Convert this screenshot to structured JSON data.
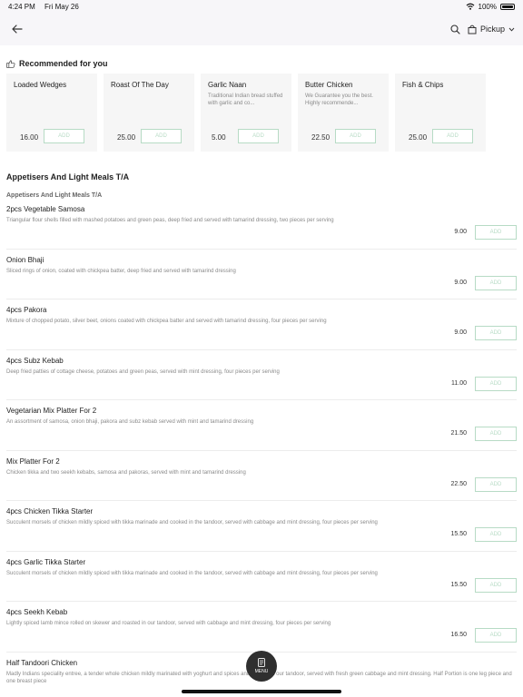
{
  "status": {
    "time": "4:24 PM",
    "date": "Fri May 26",
    "battery": "100%"
  },
  "header": {
    "pickup_label": "Pickup"
  },
  "recommended": {
    "title": "Recommended for you",
    "items": [
      {
        "name": "Loaded Wedges",
        "desc": "",
        "price": "16.00",
        "add": "ADD"
      },
      {
        "name": "Roast Of The Day",
        "desc": "",
        "price": "25.00",
        "add": "ADD"
      },
      {
        "name": "Garlic Naan",
        "desc": "Traditional Indian bread stuffed with garlic and co...",
        "price": "5.00",
        "add": "ADD"
      },
      {
        "name": "Butter Chicken",
        "desc": "We Guarantee you the best. Highly recommende...",
        "price": "22.50",
        "add": "ADD"
      },
      {
        "name": "Fish & Chips",
        "desc": "",
        "price": "25.00",
        "add": "ADD"
      }
    ]
  },
  "section": {
    "title": "Appetisers And Light Meals T/A",
    "subtitle": "Appetisers And Light Meals T/A"
  },
  "menu": [
    {
      "name": "2pcs Vegetable Samosa",
      "desc": "Triangular flour shells filled with mashed potatoes and green peas, deep fried and served with tamarind dressing, two pieces per serving",
      "price": "9.00",
      "add": "ADD"
    },
    {
      "name": "Onion Bhaji",
      "desc": "Sliced rings of onion, coated with chickpea batter, deep fried and served with tamarind dressing",
      "price": "9.00",
      "add": "ADD"
    },
    {
      "name": "4pcs Pakora",
      "desc": "Mixture of chopped potato, silver beet, onions coated with chickpea batter and served with tamarind dressing, four pieces per serving",
      "price": "9.00",
      "add": "ADD"
    },
    {
      "name": "4pcs Subz Kebab",
      "desc": "Deep fried patties of cottage cheese, potatoes and green peas, served with mint dressing, four pieces per serving",
      "price": "11.00",
      "add": "ADD"
    },
    {
      "name": "Vegetarian Mix Platter For 2",
      "desc": "An assortment of samosa, onion bhaji, pakora and subz kebab served with mint and tamarind dressing",
      "price": "21.50",
      "add": "ADD"
    },
    {
      "name": "Mix Platter For 2",
      "desc": "Chicken tikka and two seekh kebabs, samosa and pakoras, served with mint and tamarind dressing",
      "price": "22.50",
      "add": "ADD"
    },
    {
      "name": "4pcs Chicken Tikka Starter",
      "desc": "Succulent morsels of chicken mildly spiced with tikka marinade and cooked in the tandoor, served with cabbage and mint dressing, four pieces per serving",
      "price": "15.50",
      "add": "ADD"
    },
    {
      "name": "4pcs Garlic Tikka Starter",
      "desc": "Succulent morsels of chicken mildly spiced with tikka marinade and cooked in the tandoor, served with cabbage and mint dressing, four pieces per serving",
      "price": "15.50",
      "add": "ADD"
    },
    {
      "name": "4pcs Seekh Kebab",
      "desc": "Lightly spiced lamb mince rolled on skewer and roasted in our tandoor, served with cabbage and mint dressing, four pieces per serving",
      "price": "16.50",
      "add": "ADD"
    },
    {
      "name": "Half Tandoori Chicken",
      "desc": "Madly Indians speciality entree, a tender whole chicken mildly marinated with yoghurt and spices and cooked in our tandoor, served with fresh green cabbage and mint dressing. Half Portion is one leg piece and one breast piece",
      "price": "",
      "add": ""
    }
  ],
  "fab": {
    "label": "MENU"
  },
  "colors": {
    "accent": "#b7dbc5",
    "header_bg": "#f7f6f9",
    "card_bg": "#f6f6f6"
  }
}
